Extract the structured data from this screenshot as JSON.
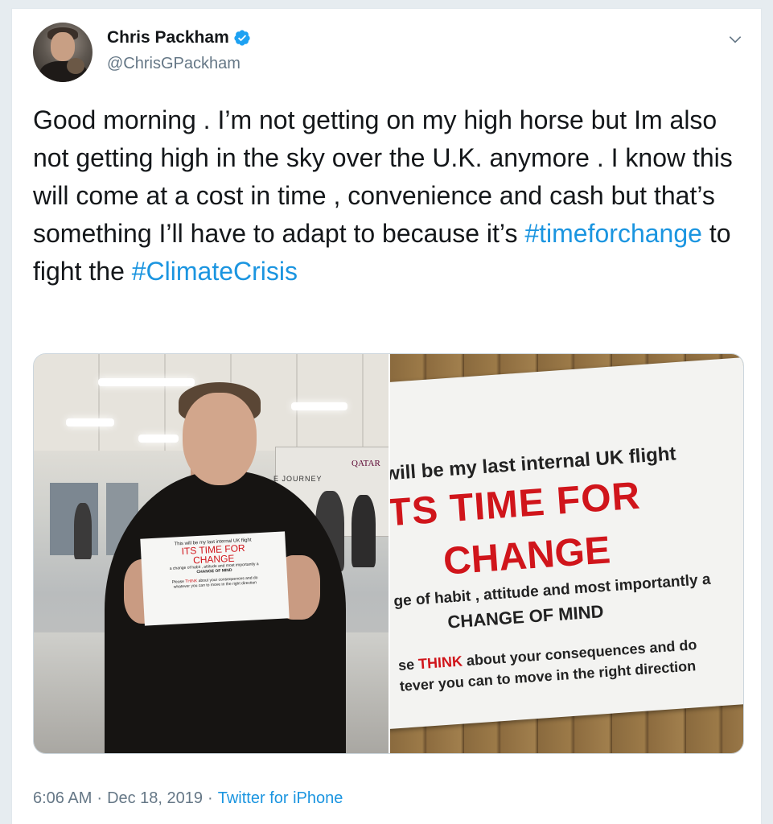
{
  "author": {
    "name": "Chris Packham",
    "handle": "@ChrisGPackham",
    "verified_icon": "verified-badge-icon"
  },
  "tweet": {
    "text_parts": [
      "Good morning . I’m not getting on my high horse but Im also not getting high in the sky over the U.K. anymore . I know this will come at a cost in time , convenience and cash but that’s something I’ll have to adapt to because it’s ",
      "#timeforchange",
      " to fight the ",
      "#ClimateCrisis"
    ]
  },
  "media": {
    "photo_left": {
      "airline_sign": "QATAR",
      "banner_text": "E JOURNEY",
      "sign": {
        "line1": "This will be my last internal UK flight",
        "line2": "ITS TIME FOR",
        "line3": "CHANGE",
        "line4": "a change of habit , attitude and most importantly a",
        "line5": "CHANGE OF MIND",
        "line6a": "Please ",
        "line6b": "THINK",
        "line6c": " about your consequences and do",
        "line7": "whatever you can to move in the right direction"
      }
    },
    "photo_right": {
      "line1": "will be my last internal UK flight",
      "line2": "TS TIME FOR",
      "line3": "CHANGE",
      "line4": "ge of habit , attitude and most importantly a",
      "line5": "CHANGE OF MIND",
      "line6a": "se ",
      "line6b": "THINK",
      "line6c": " about your consequences and do",
      "line7": "tever you can to move in the right direction"
    }
  },
  "footer": {
    "time": "6:06 AM",
    "separator": "·",
    "date": "Dec 18, 2019",
    "source": "Twitter for iPhone"
  },
  "colors": {
    "link": "#1b95e0",
    "text": "#14171a",
    "secondary": "#657786",
    "sign_red": "#d0151b"
  }
}
